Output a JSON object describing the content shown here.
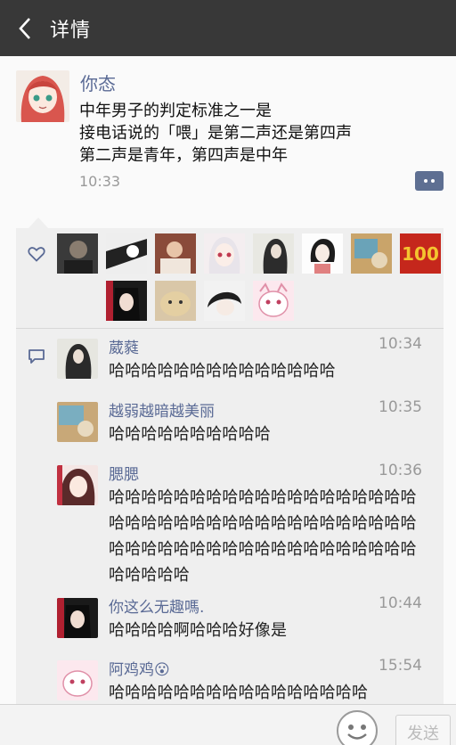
{
  "topbar": {
    "back_icon": "chevron-left-icon",
    "title": "详情"
  },
  "post": {
    "author": "你态",
    "lines": [
      "中年男子的判定标准之一是",
      "接电话说的「喂」是第二声还是第四声",
      "第二声是青年，第四声是中年"
    ],
    "time": "10:33"
  },
  "likes": {
    "icon": "heart-icon",
    "count": 13
  },
  "comments_icon": "comment-bubble-icon",
  "comments": [
    {
      "name": "葳蕤",
      "time": "10:34",
      "text": "哈哈哈哈哈哈哈哈哈哈哈哈哈哈"
    },
    {
      "name": "越弱越暗越美丽",
      "time": "10:35",
      "text": "哈哈哈哈哈哈哈哈哈哈"
    },
    {
      "name": "腮腮",
      "time": "10:36",
      "text": "哈哈哈哈哈哈哈哈哈哈哈哈哈哈哈哈哈哈哈哈哈哈哈哈哈哈哈哈哈哈哈哈哈哈哈哈哈哈哈哈哈哈哈哈哈哈哈哈哈哈哈哈哈哈哈哈哈哈哈哈哈哈"
    },
    {
      "name": "你这么无趣嗎.",
      "time": "10:44",
      "text": "哈哈哈哈啊哈哈哈好像是"
    },
    {
      "name": "阿鸡鸡😮",
      "time": "15:54",
      "text": "哈哈哈哈哈哈哈哈哈哈哈哈哈哈哈哈"
    }
  ],
  "input_bar": {
    "emoji_icon": "smiley-icon",
    "send_label": "发送"
  },
  "colors": {
    "topbar": "#383838",
    "name_link": "#5a6a95",
    "panel": "#efefef"
  }
}
